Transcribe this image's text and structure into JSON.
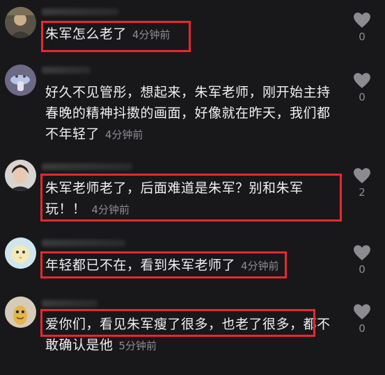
{
  "comments": [
    {
      "text": "朱军怎么老了",
      "time": "4分钟前",
      "likes": "0",
      "avatar_icon": "person-photo-avatar"
    },
    {
      "text": "好久不见管彤，想起来，朱军老师，刚开始主持春晚的精神抖擞的画面，好像就在昨天，我们都不年轻了",
      "time": "4分钟前",
      "likes": "0",
      "avatar_icon": "cartoon-avatar"
    },
    {
      "text": "朱军老师老了，后面难道是朱军？别和朱军玩！！",
      "time": "4分钟前",
      "likes": "2",
      "avatar_icon": "woman-photo-avatar"
    },
    {
      "text": "年轻都已不在，看到朱军老师了",
      "time": "4分钟前",
      "likes": "0",
      "avatar_icon": "cartoon-bird-avatar"
    },
    {
      "text": "爱你们，看见朱军瘦了很多，也老了很多，都不敢确认是他",
      "time": "5分钟前",
      "likes": "0",
      "avatar_icon": "cartoon-character-avatar"
    }
  ],
  "colors": {
    "background": "#18181b",
    "highlight": "#e8282e",
    "muted": "#8d8d92"
  }
}
